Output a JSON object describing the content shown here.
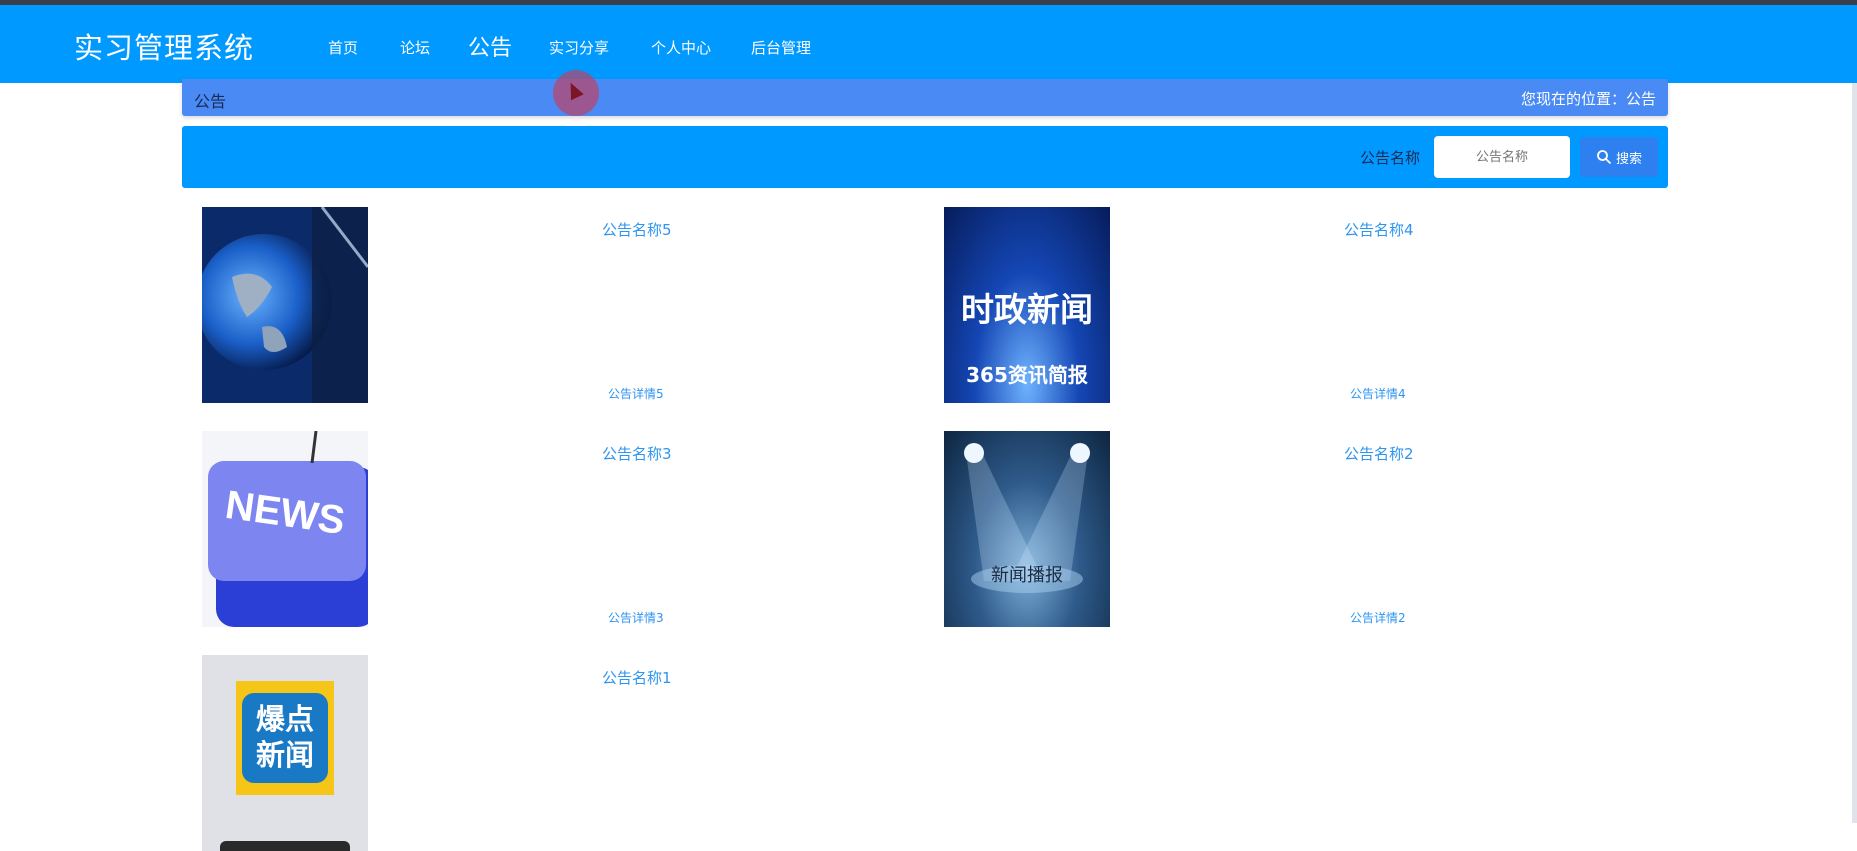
{
  "app": {
    "title": "实习管理系统"
  },
  "nav": {
    "items": [
      {
        "label": "首页"
      },
      {
        "label": "论坛"
      },
      {
        "label": "公告"
      },
      {
        "label": "实习分享"
      },
      {
        "label": "个人中心"
      },
      {
        "label": "后台管理"
      }
    ],
    "active_index": 2
  },
  "breadcrumb": {
    "title": "公告",
    "location": "您现在的位置：公告"
  },
  "search": {
    "label": "公告名称",
    "placeholder": "公告名称",
    "button_label": "搜索"
  },
  "announcements": [
    {
      "name": "公告名称5",
      "detail": "公告详情5",
      "thumb_icon": "globe-news-image"
    },
    {
      "name": "公告名称4",
      "detail": "公告详情4",
      "thumb_icon": "politics-news-image",
      "thumb_text": "时政新闻",
      "thumb_sub": "365资讯简报"
    },
    {
      "name": "公告名称3",
      "detail": "公告详情3",
      "thumb_icon": "news-key-image",
      "thumb_text": "NEWS"
    },
    {
      "name": "公告名称2",
      "detail": "公告详情2",
      "thumb_icon": "spotlight-stage-image",
      "thumb_text": "新闻播报"
    },
    {
      "name": "公告名称1",
      "detail": "",
      "thumb_icon": "hot-news-image",
      "thumb_text": "爆点新闻"
    }
  ],
  "colors": {
    "nav_bg": "#0099ff",
    "breadcrumb_bg": "#4a8af4",
    "link": "#2e95f0",
    "search_button": "#2e7ff0"
  }
}
